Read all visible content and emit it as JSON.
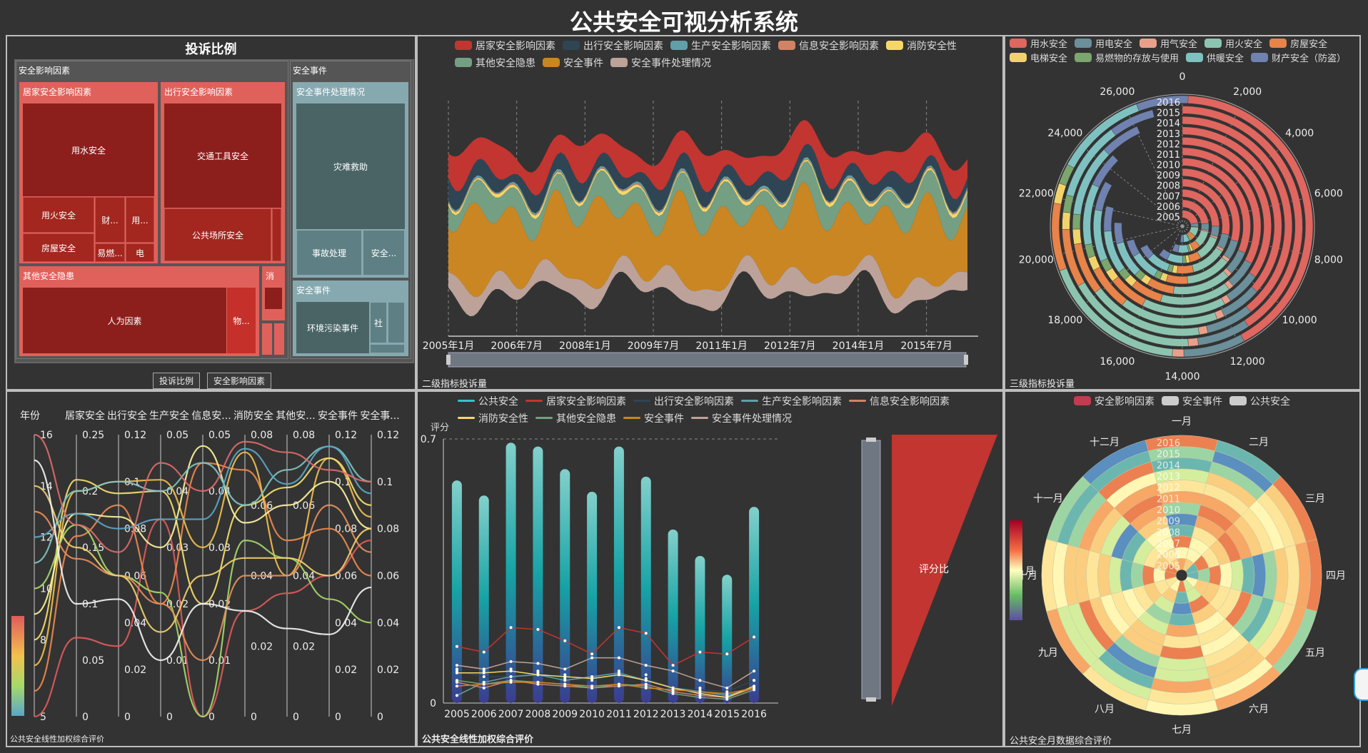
{
  "title": "公共安全可视分析系统",
  "colors": [
    "#c23531",
    "#2f4554",
    "#61a0a8",
    "#d48265",
    "#91c7ae",
    "#749f83",
    "#ca8622",
    "#bda29a",
    "#6e7074",
    "#546570",
    "#c4ccd3"
  ],
  "treemap": {
    "title": "投诉比例",
    "groups": {
      "g1": "安全影响因素",
      "g2": "安全事件",
      "home": "居家安全影响因素",
      "travel": "出行安全影响因素",
      "other": "其他安全隐患",
      "handle": "安全事件处理情况",
      "event": "安全事件"
    },
    "leaves": {
      "water": "用水安全",
      "fire": "用火安全",
      "house": "房屋安全",
      "cai": "财...",
      "yong": "用...",
      "yiran": "易燃...",
      "dian": "电",
      "vehicle": "交通工具安全",
      "public": "公共场所安全",
      "human": "人为因素",
      "wu": "物...",
      "xiao": "消",
      "rescue": "灾难救助",
      "accident": "事故处理",
      "anquan": "安全...",
      "pollution": "环境污染事件",
      "she": "社"
    },
    "breadcrumb": [
      "投诉比例",
      "安全影响因素"
    ]
  },
  "stream": {
    "caption": "二级指标投诉量",
    "legend": [
      "居家安全影响因素",
      "出行安全影响因素",
      "生产安全影响因素",
      "信息安全影响因素",
      "消防安全性",
      "其他安全隐患",
      "安全事件",
      "安全事件处理情况"
    ],
    "legend_colors": [
      "#c23531",
      "#2f4554",
      "#61a0a8",
      "#d48265",
      "#f5d769",
      "#749f83",
      "#ca8622",
      "#bda29a"
    ],
    "x_labels": [
      "2005年1月",
      "2006年7月",
      "2008年1月",
      "2009年7月",
      "2011年1月",
      "2012年7月",
      "2014年1月",
      "2015年7月"
    ],
    "start": "2005-01",
    "months": 144
  },
  "polar_bar": {
    "caption": "三级指标投诉量",
    "legend": [
      "用水安全",
      "用电安全",
      "用气安全",
      "用火安全",
      "房屋安全",
      "电梯安全",
      "易燃物的存放与使用",
      "供暖安全",
      "财产安全（防盗）"
    ],
    "legend_colors": [
      "#e06660",
      "#6b8f9b",
      "#e8a08a",
      "#8cc4b0",
      "#e8834a",
      "#f2d36b",
      "#7ba66e",
      "#7fc1c0",
      "#6f82b0"
    ],
    "years": [
      "2016",
      "2015",
      "2014",
      "2013",
      "2012",
      "2011",
      "2010",
      "2009",
      "2008",
      "2007",
      "2006",
      "2005"
    ],
    "angle_ticks": [
      "0",
      "2,000",
      "4,000",
      "6,000",
      "8,000",
      "10,000",
      "12,000",
      "14,000",
      "16,000",
      "18,000",
      "20,000",
      "22,000",
      "24,000",
      "26,000"
    ],
    "angle_max": 28000,
    "category_totals": [
      [
        11800,
        2150,
        400,
        5100,
        2350,
        700,
        700,
        3200,
        1800
      ],
      [
        11400,
        2000,
        380,
        4900,
        2200,
        650,
        650,
        3000,
        1700
      ],
      [
        11000,
        1950,
        360,
        4800,
        2150,
        620,
        620,
        2950,
        1650
      ],
      [
        10200,
        1850,
        350,
        4500,
        2050,
        600,
        600,
        2800,
        1600
      ],
      [
        9700,
        1750,
        330,
        4300,
        1950,
        580,
        580,
        2650,
        1500
      ],
      [
        9200,
        1650,
        310,
        4100,
        1850,
        550,
        550,
        2500,
        1450
      ],
      [
        8800,
        1600,
        300,
        3900,
        1800,
        520,
        520,
        2400,
        1400
      ],
      [
        8200,
        1500,
        280,
        3600,
        1700,
        500,
        500,
        2250,
        1300
      ],
      [
        7800,
        1450,
        260,
        3400,
        1600,
        470,
        470,
        2150,
        1250
      ],
      [
        7000,
        1300,
        240,
        3100,
        1450,
        430,
        430,
        1950,
        1150
      ],
      [
        6500,
        1200,
        220,
        2850,
        1350,
        400,
        400,
        1800,
        1050
      ],
      [
        6000,
        1100,
        200,
        2650,
        1250,
        380,
        380,
        1650,
        980
      ]
    ]
  },
  "parallel": {
    "caption": "公共安全线性加权综合评价",
    "axes": [
      {
        "name": "年份",
        "ticks": [
          "16",
          "14",
          "12",
          "10",
          "8",
          "5"
        ],
        "max": 16,
        "min": 5
      },
      {
        "name": "居家安全",
        "ticks": [
          "0.25",
          "0.2",
          "0.15",
          "0.1",
          "0.05",
          "0"
        ],
        "max": 0.25,
        "min": 0
      },
      {
        "name": "出行安全",
        "ticks": [
          "0.12",
          "0.1",
          "0.08",
          "0.06",
          "0.04",
          "0.02",
          "0"
        ],
        "max": 0.12,
        "min": 0
      },
      {
        "name": "生产安全",
        "ticks": [
          "0.05",
          "0.04",
          "0.03",
          "0.02",
          "0.01",
          "0"
        ],
        "max": 0.05,
        "min": 0
      },
      {
        "name": "信息安...",
        "ticks": [
          "0.05",
          "0.04",
          "0.03",
          "0.02",
          "0.01",
          "0"
        ],
        "max": 0.05,
        "min": 0
      },
      {
        "name": "消防安全",
        "ticks": [
          "0.08",
          "0.06",
          "0.04",
          "0.02",
          "0"
        ],
        "max": 0.08,
        "min": 0
      },
      {
        "name": "其他安...",
        "ticks": [
          "0.08",
          "0.06",
          "0.04",
          "0.02",
          "0"
        ],
        "max": 0.08,
        "min": 0
      },
      {
        "name": "安全事件",
        "ticks": [
          "0.12",
          "0.1",
          "0.08",
          "0.06",
          "0.04",
          "0.02",
          "0"
        ],
        "max": 0.12,
        "min": 0
      },
      {
        "name": "安全事...",
        "ticks": [
          "0.12",
          "0.1",
          "0.08",
          "0.06",
          "0.04",
          "0.02",
          "0"
        ],
        "max": 0.12,
        "min": 0
      }
    ],
    "rows": [
      [
        5,
        0.07,
        0.03,
        0.035,
        0.0,
        0.03,
        0.035,
        0.06,
        0.075
      ],
      [
        6,
        0.16,
        0.09,
        0.02,
        0.045,
        0.07,
        0.05,
        0.08,
        0.06
      ],
      [
        7,
        0.2,
        0.1,
        0.042,
        0.03,
        0.075,
        0.04,
        0.11,
        0.085
      ],
      [
        8,
        0.21,
        0.095,
        0.04,
        0.02,
        0.06,
        0.065,
        0.11,
        0.09
      ],
      [
        9,
        0.18,
        0.085,
        0.03,
        0.048,
        0.055,
        0.06,
        0.1,
        0.08
      ],
      [
        10,
        0.17,
        0.06,
        0.022,
        0.0,
        0.05,
        0.045,
        0.05,
        0.04
      ],
      [
        11,
        0.2,
        0.1,
        0.04,
        0.045,
        0.06,
        0.07,
        0.115,
        0.1
      ],
      [
        12,
        0.18,
        0.08,
        0.035,
        0.035,
        0.076,
        0.066,
        0.115,
        0.095
      ],
      [
        13,
        0.14,
        0.06,
        0.02,
        0.01,
        0.04,
        0.04,
        0.09,
        0.07
      ],
      [
        14,
        0.15,
        0.06,
        0.015,
        0.025,
        0.045,
        0.045,
        0.06,
        0.08
      ],
      [
        15,
        0.1,
        0.05,
        0.01,
        0.02,
        0.03,
        0.025,
        0.035,
        0.055
      ],
      [
        16,
        0.17,
        0.07,
        0.045,
        0.04,
        0.078,
        0.075,
        0.105,
        0.1
      ]
    ]
  },
  "bar_line": {
    "caption": "公共安全线性加权综合评价",
    "legend": [
      "公共安全",
      "居家安全影响因素",
      "出行安全影响因素",
      "生产安全影响因素",
      "信息安全影响因素",
      "消防安全性",
      "其他安全隐患",
      "安全事件",
      "安全事件处理情况"
    ],
    "legend_colors": [
      "#2ec7c9",
      "#c23531",
      "#2f4554",
      "#61a0a8",
      "#d48265",
      "#f5d769",
      "#749f83",
      "#ca8622",
      "#bda29a"
    ],
    "ylabel": "评分",
    "ylim": [
      0,
      0.7
    ],
    "y_ticks": [
      "0.7",
      "0"
    ],
    "categories": [
      "2005",
      "2006",
      "2007",
      "2008",
      "2009",
      "2010",
      "2011",
      "2012",
      "2013",
      "2014",
      "2015",
      "2016"
    ],
    "bars": [
      0.59,
      0.55,
      0.69,
      0.68,
      0.62,
      0.56,
      0.68,
      0.6,
      0.46,
      0.39,
      0.34,
      0.52
    ],
    "lines": [
      [
        0.15,
        0.135,
        0.2,
        0.195,
        0.165,
        0.13,
        0.2,
        0.185,
        0.1,
        0.135,
        0.13,
        0.175
      ],
      [
        0.085,
        0.07,
        0.07,
        0.08,
        0.065,
        0.06,
        0.075,
        0.065,
        0.04,
        0.035,
        0.03,
        0.06
      ],
      [
        0.02,
        0.055,
        0.07,
        0.075,
        0.06,
        0.07,
        0.08,
        0.06,
        0.04,
        0.03,
        0.02,
        0.04
      ],
      [
        0.055,
        0.04,
        0.06,
        0.05,
        0.045,
        0.04,
        0.045,
        0.05,
        0.03,
        0.02,
        0.015,
        0.04
      ],
      [
        0.08,
        0.08,
        0.085,
        0.075,
        0.07,
        0.065,
        0.075,
        0.06,
        0.04,
        0.025,
        0.015,
        0.045
      ],
      [
        0.06,
        0.05,
        0.06,
        0.055,
        0.05,
        0.04,
        0.05,
        0.045,
        0.025,
        0.015,
        0.01,
        0.035
      ],
      [
        0.045,
        0.05,
        0.055,
        0.055,
        0.05,
        0.045,
        0.05,
        0.04,
        0.035,
        0.03,
        0.025,
        0.04
      ],
      [
        0.1,
        0.09,
        0.11,
        0.105,
        0.09,
        0.12,
        0.12,
        0.1,
        0.085,
        0.06,
        0.04,
        0.085
      ],
      [
        0.09,
        0.085,
        0.09,
        0.085,
        0.075,
        0.065,
        0.085,
        0.075,
        0.04,
        0.04,
        0.02,
        0.06
      ]
    ],
    "funnel_label": "评分比"
  },
  "polar_heat": {
    "caption": "公共安全月数据综合评价",
    "legend": [
      "安全影响因素",
      "安全事件",
      "公共安全"
    ],
    "legend_colors": [
      "#c23b4f",
      "#cccccc",
      "#cccccc"
    ],
    "months": [
      "一月",
      "二月",
      "三月",
      "四月",
      "五月",
      "六月",
      "七月",
      "八月",
      "九月",
      "十月",
      "十一月",
      "十二月"
    ],
    "years": [
      "2016",
      "2015",
      "2014",
      "2013",
      "2012",
      "2011",
      "2010",
      "2009",
      "2008",
      "2007",
      "2006",
      "2005"
    ],
    "visual_label": "月"
  }
}
